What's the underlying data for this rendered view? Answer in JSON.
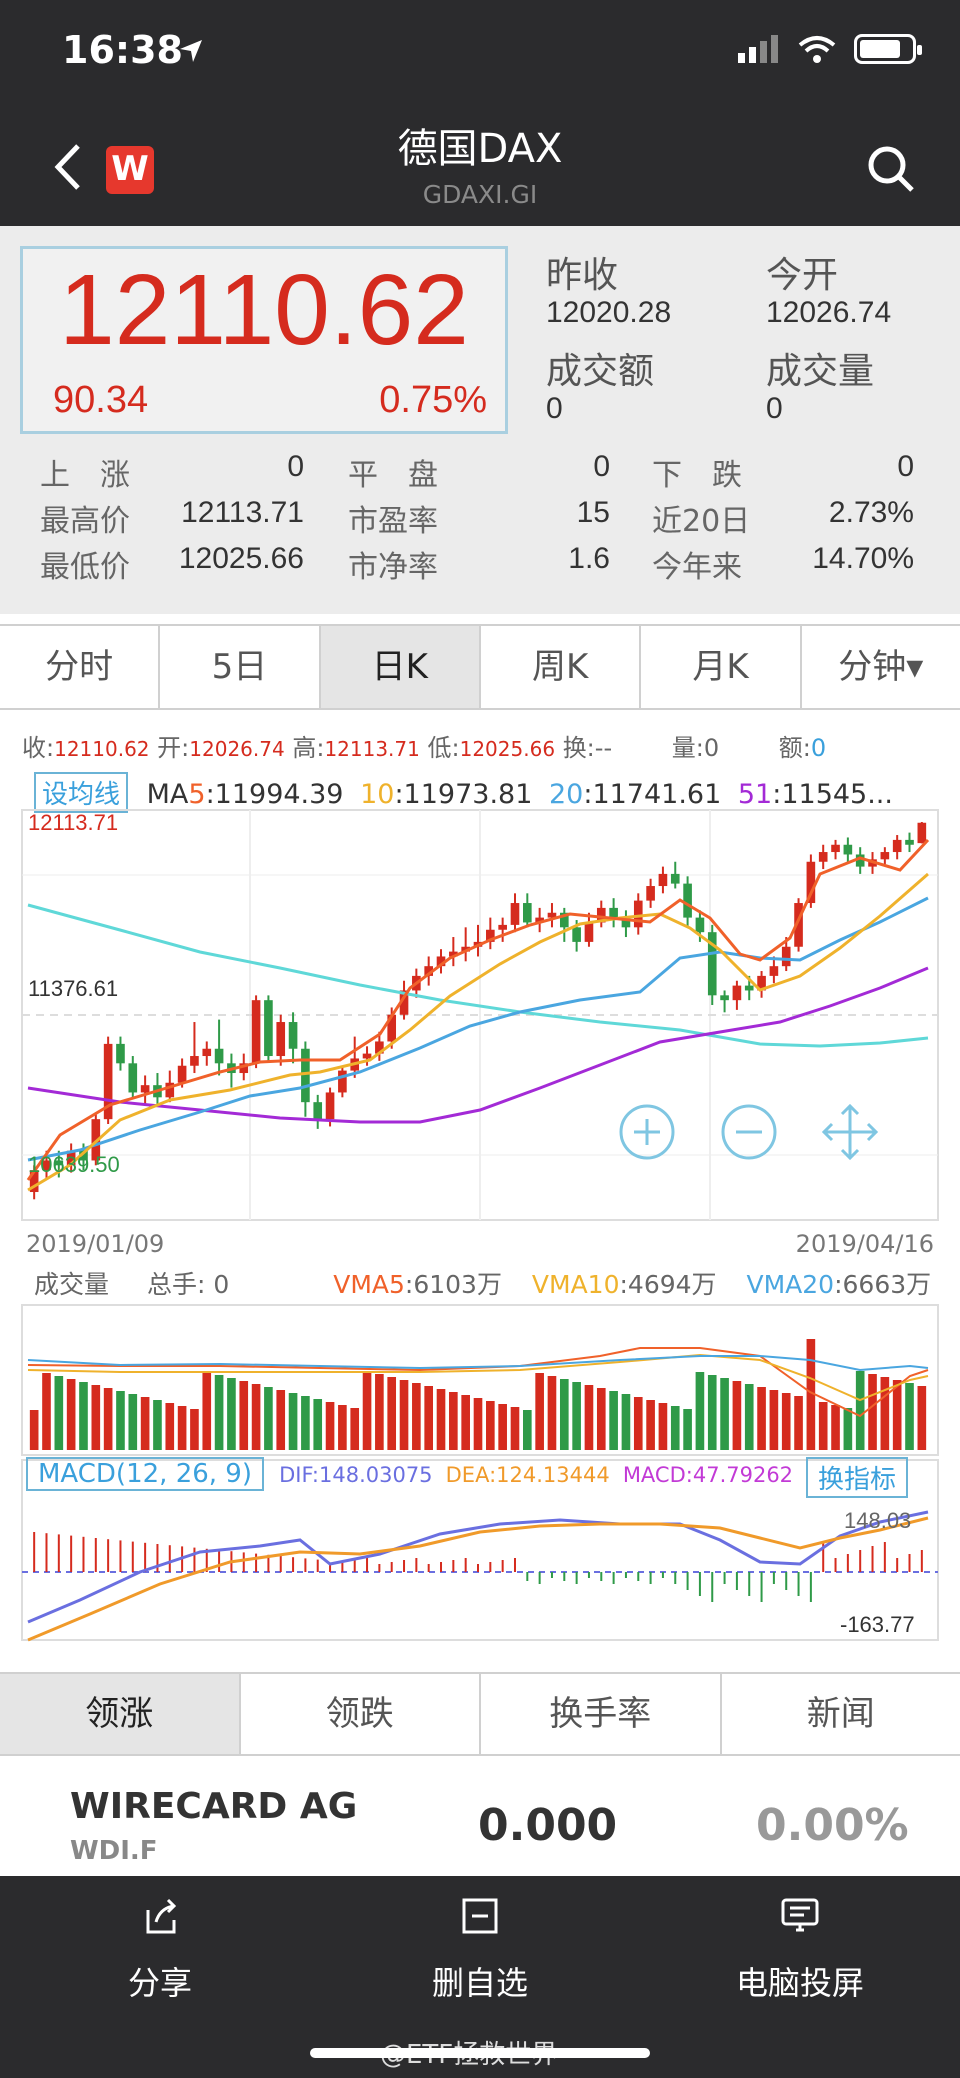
{
  "status_bar": {
    "time": "16:38",
    "battery_level": 0.8
  },
  "nav": {
    "title": "德国DAX",
    "subtitle": "GDAXI.GI",
    "logo_letter": "W"
  },
  "quote": {
    "price": "12110.62",
    "change": "90.34",
    "change_pct": "0.75%",
    "prev_close_label": "昨收",
    "prev_close": "12020.28",
    "open_label": "今开",
    "open": "12026.74",
    "amount_label": "成交额",
    "amount": "0",
    "volume_label": "成交量",
    "volume": "0"
  },
  "stats": [
    {
      "l1": "上　涨",
      "v1": "0",
      "l2": "平　盘",
      "v2": "0",
      "l3": "下　跌",
      "v3": "0"
    },
    {
      "l1": "最高价",
      "v1": "12113.71",
      "l2": "市盈率",
      "v2": "15",
      "l3": "近20日",
      "v3": "2.73%"
    },
    {
      "l1": "最低价",
      "v1": "12025.66",
      "l2": "市净率",
      "v2": "1.6",
      "l3": "今年来",
      "v3": "14.70%"
    }
  ],
  "tabs": [
    "分时",
    "5日",
    "日K",
    "周K",
    "月K",
    "分钟▾"
  ],
  "active_tab": "日K",
  "chart_info": {
    "close_label": "收:",
    "close": "12110.62",
    "open_label": "开:",
    "open": "12026.74",
    "high_label": "高:",
    "high": "12113.71",
    "low_label": "低:",
    "low": "12025.66",
    "turnover_label": "换:",
    "turnover": "--",
    "vol_label": "量:",
    "vol": "0",
    "amt_label": "额:",
    "amt": "0"
  },
  "ma": {
    "button": "设均线",
    "ma5_label": "MA5",
    "ma5": ":11994.39",
    "ma10_label": "10",
    "ma10": ":11973.81",
    "ma20_label": "20",
    "ma20": ":11741.61",
    "ma51_label": "51",
    "ma51": ":11545..."
  },
  "k_axis": {
    "top": "12113.71",
    "mid": "11376.61",
    "bottom": "10639.50",
    "date_start": "2019/01/09",
    "date_end": "2019/04/16"
  },
  "volume": {
    "label": "成交量",
    "total_label": "总手:",
    "total": "0",
    "vma5_label": "VMA5",
    "vma5": ":6103万",
    "vma10_label": "VMA10",
    "vma10": ":4694万",
    "vma20_label": "VMA20",
    "vma20": ":6663万"
  },
  "macd": {
    "button": "MACD(12, 26, 9)",
    "dif_label": "DIF",
    "dif": ":148.03075",
    "dea_label": "DEA",
    "dea": ":124.13444",
    "macd_label": "MACD",
    "macd": ":47.79262",
    "swap": "换指标",
    "top": "148.03",
    "bottom": "-163.77"
  },
  "list_tabs": [
    "领涨",
    "领跌",
    "换手率",
    "新闻"
  ],
  "stock": {
    "name": "WIRECARD AG",
    "code": "WDI.F",
    "price": "0.000",
    "pct": "0.00%"
  },
  "bottom_bar": {
    "share": "分享",
    "remove": "删自选",
    "cast": "电脑投屏",
    "watermark": "@ETF拯救世界"
  },
  "colors": {
    "up": "#d52b1e",
    "down": "#2f9a48",
    "ma5": "#f0612a",
    "ma10": "#efb22c",
    "ma20": "#4aa6e0",
    "ma51": "#a32ad6",
    "ma_long": "#5fd8d8"
  },
  "chart_data": {
    "type": "candlestick",
    "x_start": "2019/01/09",
    "x_end": "2019/04/16",
    "ylim": [
      10639.5,
      12113.71
    ],
    "candles": [
      [
        10590,
        10680,
        10560,
        10700
      ],
      [
        10680,
        10720,
        10640,
        10760
      ],
      [
        10720,
        10700,
        10650,
        10760
      ],
      [
        10700,
        10760,
        10670,
        10790
      ],
      [
        10760,
        10720,
        10680,
        10790
      ],
      [
        10720,
        10890,
        10700,
        10910
      ],
      [
        10890,
        11200,
        10870,
        11230
      ],
      [
        11200,
        11120,
        11090,
        11230
      ],
      [
        11120,
        11000,
        10980,
        11150
      ],
      [
        11000,
        11030,
        10950,
        11070
      ],
      [
        11030,
        10980,
        10950,
        11080
      ],
      [
        10980,
        11040,
        10960,
        11090
      ],
      [
        11040,
        11110,
        11020,
        11140
      ],
      [
        11110,
        11150,
        11080,
        11290
      ],
      [
        11150,
        11180,
        11110,
        11210
      ],
      [
        11180,
        11120,
        11070,
        11300
      ],
      [
        11120,
        11080,
        11020,
        11160
      ],
      [
        11080,
        11120,
        11050,
        11160
      ],
      [
        11120,
        11380,
        11100,
        11400
      ],
      [
        11380,
        11150,
        11130,
        11400
      ],
      [
        11150,
        11290,
        11110,
        11320
      ],
      [
        11290,
        11180,
        11120,
        11330
      ],
      [
        11180,
        10960,
        10900,
        11210
      ],
      [
        10960,
        10890,
        10850,
        10990
      ],
      [
        10890,
        11000,
        10860,
        11020
      ],
      [
        11000,
        11090,
        10980,
        11110
      ],
      [
        11090,
        11140,
        11060,
        11230
      ],
      [
        11140,
        11160,
        11110,
        11190
      ],
      [
        11160,
        11210,
        11130,
        11250
      ],
      [
        11210,
        11320,
        11180,
        11350
      ],
      [
        11320,
        11420,
        11300,
        11460
      ],
      [
        11420,
        11480,
        11390,
        11510
      ],
      [
        11480,
        11520,
        11440,
        11560
      ],
      [
        11520,
        11560,
        11490,
        11590
      ],
      [
        11560,
        11580,
        11520,
        11640
      ],
      [
        11580,
        11600,
        11540,
        11680
      ],
      [
        11600,
        11620,
        11560,
        11690
      ],
      [
        11620,
        11670,
        11590,
        11720
      ],
      [
        11670,
        11690,
        11620,
        11720
      ],
      [
        11690,
        11780,
        11660,
        11820
      ],
      [
        11780,
        11700,
        11680,
        11820
      ],
      [
        11700,
        11720,
        11660,
        11760
      ],
      [
        11720,
        11740,
        11680,
        11780
      ],
      [
        11740,
        11680,
        11620,
        11760
      ],
      [
        11680,
        11620,
        11580,
        11710
      ],
      [
        11620,
        11700,
        11600,
        11740
      ],
      [
        11700,
        11760,
        11680,
        11790
      ],
      [
        11760,
        11720,
        11680,
        11800
      ],
      [
        11720,
        11680,
        11640,
        11750
      ],
      [
        11680,
        11790,
        11650,
        11820
      ],
      [
        11790,
        11850,
        11760,
        11880
      ],
      [
        11850,
        11900,
        11820,
        11930
      ],
      [
        11900,
        11860,
        11840,
        11950
      ],
      [
        11860,
        11720,
        11680,
        11890
      ],
      [
        11720,
        11660,
        11620,
        11750
      ],
      [
        11660,
        11400,
        11360,
        11690
      ],
      [
        11400,
        11380,
        11330,
        11420
      ],
      [
        11380,
        11440,
        11340,
        11460
      ],
      [
        11440,
        11420,
        11380,
        11480
      ],
      [
        11420,
        11480,
        11390,
        11500
      ],
      [
        11480,
        11520,
        11450,
        11560
      ],
      [
        11520,
        11600,
        11500,
        11640
      ],
      [
        11600,
        11780,
        11580,
        11800
      ],
      [
        11780,
        11950,
        11760,
        11980
      ],
      [
        11950,
        11990,
        11920,
        12020
      ],
      [
        11990,
        12020,
        11960,
        12040
      ],
      [
        12020,
        11980,
        11950,
        12050
      ],
      [
        11980,
        11930,
        11900,
        12010
      ],
      [
        11930,
        11960,
        11900,
        11990
      ],
      [
        11960,
        11990,
        11940,
        12010
      ],
      [
        11990,
        12040,
        11960,
        12060
      ],
      [
        12040,
        12020,
        11990,
        12070
      ],
      [
        12026.74,
        12110.62,
        12025.66,
        12113.71
      ]
    ]
  }
}
